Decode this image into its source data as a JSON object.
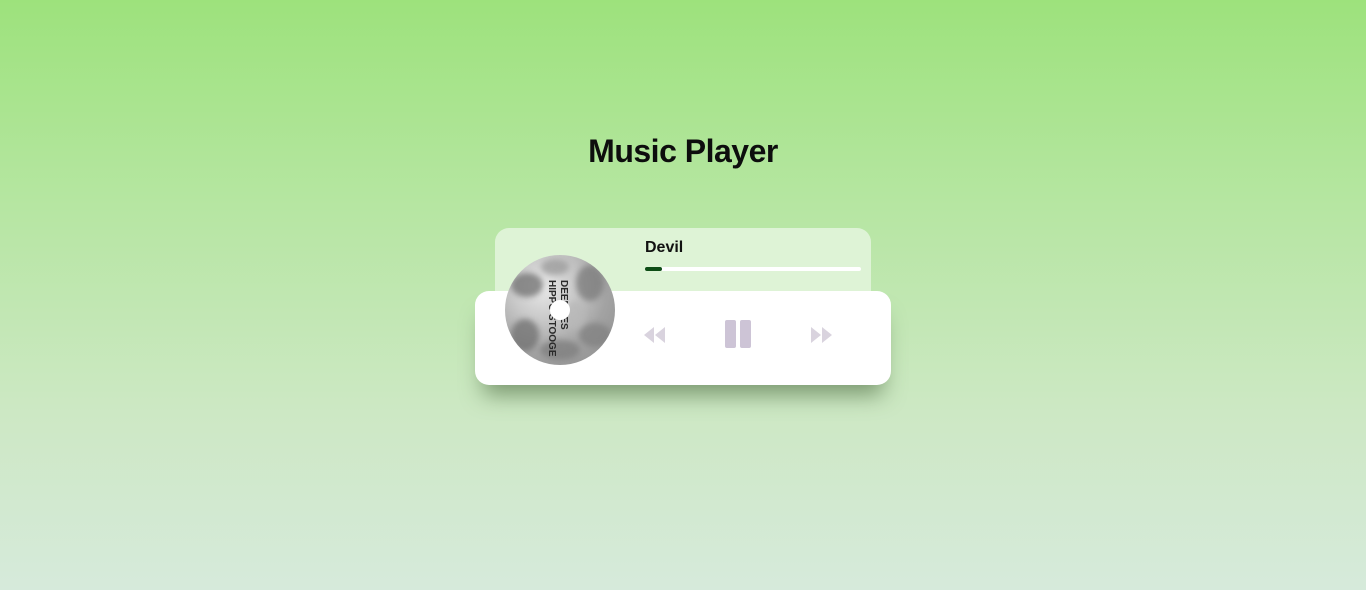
{
  "page": {
    "title": "Music Player"
  },
  "player": {
    "track_title": "Devil",
    "progress_fraction": 0.08,
    "album_art_text": [
      "DEEP YES",
      "HIPPO STOOGE"
    ],
    "controls": {
      "prev_icon": "rewind-icon",
      "play_icon": "pause-icon",
      "next_icon": "fast-forward-icon"
    }
  },
  "colors": {
    "progress_fill": "#0e4d16",
    "info_panel": "#def3d6",
    "control_icon": "#d9d3de",
    "pause_icon": "#cdc4d6"
  }
}
